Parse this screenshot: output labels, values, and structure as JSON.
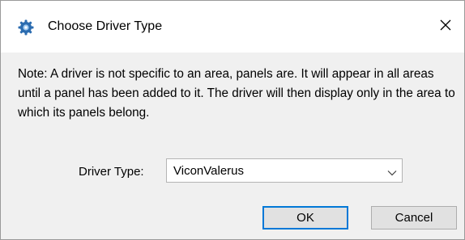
{
  "window": {
    "title": "Choose Driver Type",
    "app_icon": "gear-icon",
    "close_icon": "close-icon"
  },
  "note": "Note: A driver is not specific to an area, panels are. It will appear in all areas until a panel has been added to it. The driver will then display only in the area to which its panels belong.",
  "driver_type": {
    "label": "Driver Type:",
    "selected": "ViconValerus",
    "dropdown_icon": "chevron-down-icon"
  },
  "buttons": {
    "ok": "OK",
    "cancel": "Cancel"
  },
  "colors": {
    "focus_border": "#0078d7",
    "dialog_background": "#f0f0f0",
    "gear_icon": "#2b6cb0"
  }
}
